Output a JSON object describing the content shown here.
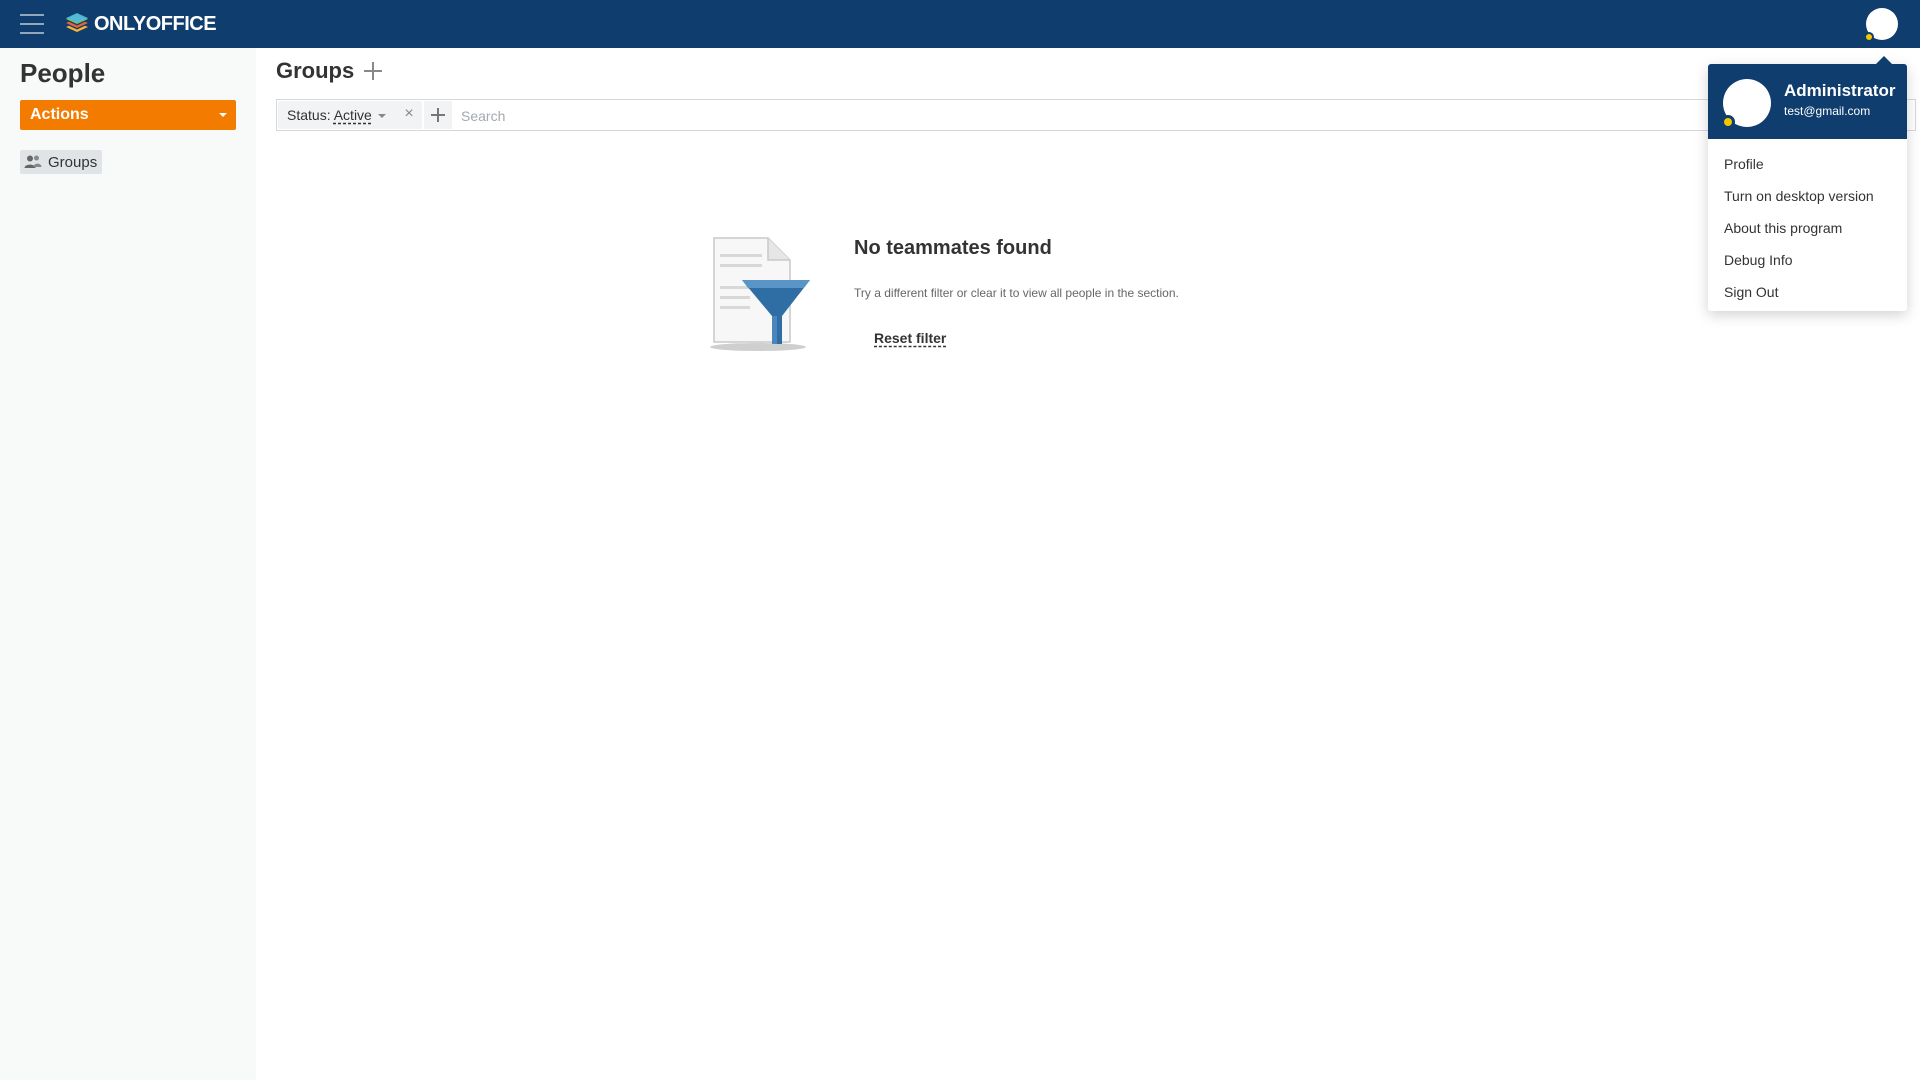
{
  "app": {
    "brand": "ONLYOFFICE",
    "module_title": "People"
  },
  "sidebar": {
    "actions_label": "Actions",
    "items": [
      {
        "label": "Groups",
        "selected": true
      }
    ]
  },
  "main": {
    "title": "Groups",
    "filter": {
      "status_label": "Status:",
      "status_value": "Active",
      "search_placeholder": "Search"
    },
    "empty_state": {
      "title": "No teammates found",
      "description": "Try a different filter or clear it to view all people in the section.",
      "reset_label": "Reset filter"
    }
  },
  "profile_menu": {
    "name": "Administrator",
    "email": "test@gmail.com",
    "items": [
      {
        "label": "Profile"
      },
      {
        "label": "Turn on desktop version"
      },
      {
        "label": "About this program"
      },
      {
        "label": "Debug Info"
      },
      {
        "label": "Sign Out"
      }
    ]
  },
  "colors": {
    "topbar": "#0f3d6e",
    "accent": "#f37c00",
    "status": "#f3c600",
    "sidebar_bg": "#f8f9f9",
    "funnel": "#2f6ea5"
  }
}
